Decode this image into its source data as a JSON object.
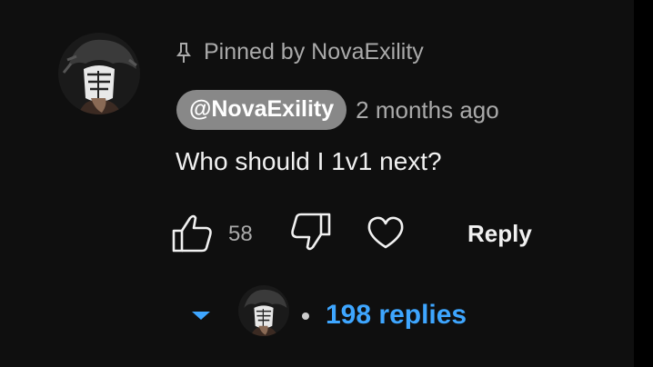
{
  "comment": {
    "pinned_label": "Pinned by NovaExility",
    "author": "@NovaExility",
    "time": "2 months ago",
    "text": "Who should I 1v1 next?",
    "like_count": "58",
    "reply_label": "Reply",
    "replies_label": "198 replies"
  },
  "icons": {
    "pin": "pin-icon",
    "like": "thumbs-up-icon",
    "dislike": "thumbs-down-icon",
    "heart": "heart-icon",
    "expand": "caret-down-icon"
  },
  "colors": {
    "background": "#0f0f0f",
    "link_blue": "#3ea6ff",
    "author_chip": "#888888",
    "secondary_text": "#aaaaaa"
  }
}
